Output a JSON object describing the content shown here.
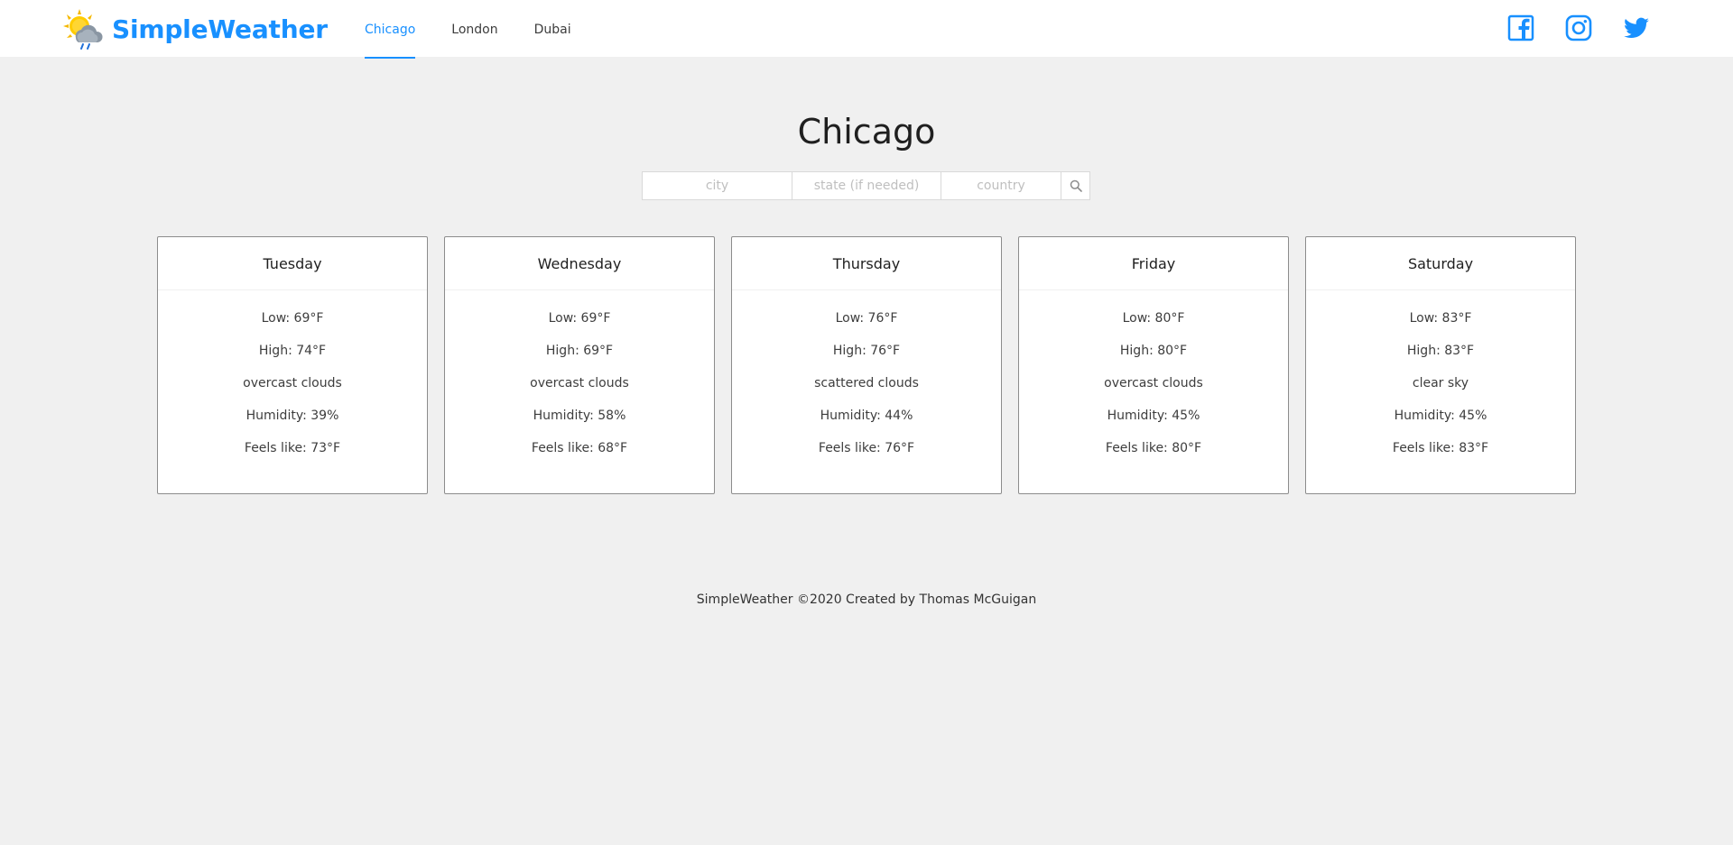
{
  "brand": {
    "name": "SimpleWeather",
    "logo_icon": "sun-cloud-rain-icon",
    "accent_color": "#1890ff"
  },
  "nav": {
    "items": [
      {
        "label": "Chicago",
        "active": true
      },
      {
        "label": "London",
        "active": false
      },
      {
        "label": "Dubai",
        "active": false
      }
    ]
  },
  "social": [
    {
      "name": "facebook-icon"
    },
    {
      "name": "instagram-icon"
    },
    {
      "name": "twitter-icon"
    }
  ],
  "page": {
    "title": "Chicago"
  },
  "search": {
    "city_placeholder": "city",
    "state_placeholder": "state (if needed)",
    "country_placeholder": "country",
    "city_value": "",
    "state_value": "",
    "country_value": "",
    "button_icon": "search-icon"
  },
  "forecast": [
    {
      "day": "Tuesday",
      "low": "Low: 69°F",
      "high": "High: 74°F",
      "description": "overcast clouds",
      "humidity": "Humidity: 39%",
      "feels_like": "Feels like: 73°F"
    },
    {
      "day": "Wednesday",
      "low": "Low: 69°F",
      "high": "High: 69°F",
      "description": "overcast clouds",
      "humidity": "Humidity: 58%",
      "feels_like": "Feels like: 68°F"
    },
    {
      "day": "Thursday",
      "low": "Low: 76°F",
      "high": "High: 76°F",
      "description": "scattered clouds",
      "humidity": "Humidity: 44%",
      "feels_like": "Feels like: 76°F"
    },
    {
      "day": "Friday",
      "low": "Low: 80°F",
      "high": "High: 80°F",
      "description": "overcast clouds",
      "humidity": "Humidity: 45%",
      "feels_like": "Feels like: 80°F"
    },
    {
      "day": "Saturday",
      "low": "Low: 83°F",
      "high": "High: 83°F",
      "description": "clear sky",
      "humidity": "Humidity: 45%",
      "feels_like": "Feels like: 83°F"
    }
  ],
  "footer": {
    "text": "SimpleWeather ©2020 Created by Thomas McGuigan"
  }
}
